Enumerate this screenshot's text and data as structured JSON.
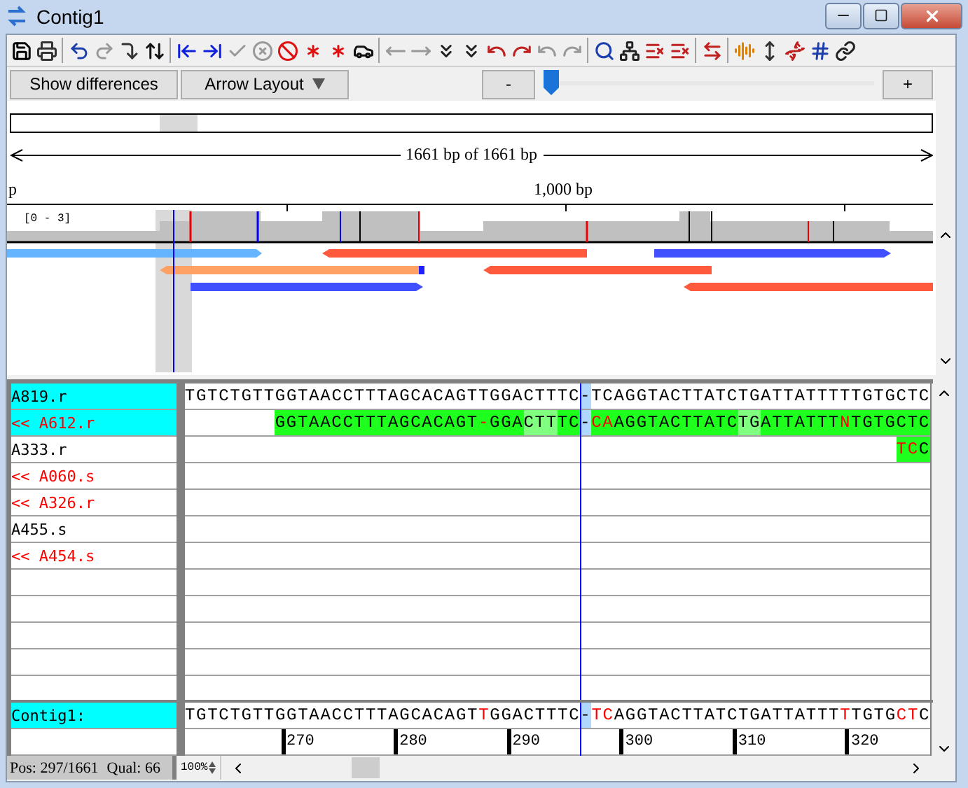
{
  "window": {
    "title": "Contig1"
  },
  "controls": {
    "differences_button": "Show differences",
    "layout_dropdown": "Arrow Layout",
    "zoom_out": "-",
    "zoom_in": "+",
    "slider": {
      "level": 0
    }
  },
  "overview": {
    "span_label": "1661 bp of 1661 bp",
    "ruler_labels": [
      "p",
      "1,000 bp"
    ],
    "coverage_label": "[0 - 3]"
  },
  "reads": [
    {
      "name": "A819.r",
      "reverse": false,
      "selected": true,
      "segments": [
        {
          "text": "TGTCTGTTGGTAACCTTTAGCACAGTTGGACTTTC",
          "kind": "plain",
          "diff": false
        },
        {
          "text": "-",
          "kind": "cursor",
          "diff": false
        },
        {
          "text": "TCAGGTACTTATCTGATTATTTTTGTGCTC",
          "kind": "plain",
          "diff": false
        }
      ]
    },
    {
      "name": "<< A612.r",
      "reverse": true,
      "selected": true,
      "segments": [
        {
          "text": "GGTAACCTTTAGCACAGT",
          "kind": "match",
          "diff": false
        },
        {
          "text": "-",
          "kind": "match",
          "diff": true
        },
        {
          "text": "GGA",
          "kind": "match",
          "diff": false
        },
        {
          "text": "CTT",
          "kind": "weak",
          "diff": false
        },
        {
          "text": "TC",
          "kind": "match",
          "diff": false
        },
        {
          "text": "-",
          "kind": "cursor",
          "diff": false
        },
        {
          "text": "CA",
          "kind": "match",
          "diff": true
        },
        {
          "text": "AGGTACTTATC",
          "kind": "match",
          "diff": false
        },
        {
          "text": "TG",
          "kind": "weak",
          "diff": false
        },
        {
          "text": "ATTATTT",
          "kind": "match",
          "diff": false
        },
        {
          "text": "N",
          "kind": "match",
          "diff": true
        },
        {
          "text": "TGTGCTC",
          "kind": "match",
          "diff": false
        }
      ]
    },
    {
      "name": "A333.r",
      "reverse": false,
      "selected": false,
      "segments": [
        {
          "text": "TC",
          "kind": "match",
          "diff": true
        },
        {
          "text": "C",
          "kind": "match",
          "diff": false
        }
      ]
    },
    {
      "name": "<< A060.s",
      "reverse": true,
      "selected": false
    },
    {
      "name": "<< A326.r",
      "reverse": true,
      "selected": false
    },
    {
      "name": "A455.s",
      "reverse": false,
      "selected": false
    },
    {
      "name": "<< A454.s",
      "reverse": true,
      "selected": false
    }
  ],
  "contig": {
    "name": "Contig1:",
    "segments": [
      {
        "text": "TGTCTGTTGGTAACCTTTAGCACAGT",
        "kind": "plain",
        "diff": false
      },
      {
        "text": "T",
        "kind": "plain",
        "diff": true
      },
      {
        "text": "GGACTTTC",
        "kind": "plain",
        "diff": false
      },
      {
        "text": "-",
        "kind": "cursor",
        "diff": false
      },
      {
        "text": "TC",
        "kind": "plain",
        "diff": true
      },
      {
        "text": "AGGTACTTATCTGATTATTT",
        "kind": "plain",
        "diff": false
      },
      {
        "text": "T",
        "kind": "plain",
        "diff": true
      },
      {
        "text": "TGTG",
        "kind": "plain",
        "diff": false
      },
      {
        "text": "CT",
        "kind": "plain",
        "diff": true
      },
      {
        "text": "C",
        "kind": "plain",
        "diff": false
      }
    ],
    "ticks": [
      "270",
      "280",
      "290",
      "300",
      "310",
      "320"
    ]
  },
  "status": {
    "position": "Pos: 297/1661",
    "quality": "Qual: 66",
    "zoom": "100%"
  }
}
